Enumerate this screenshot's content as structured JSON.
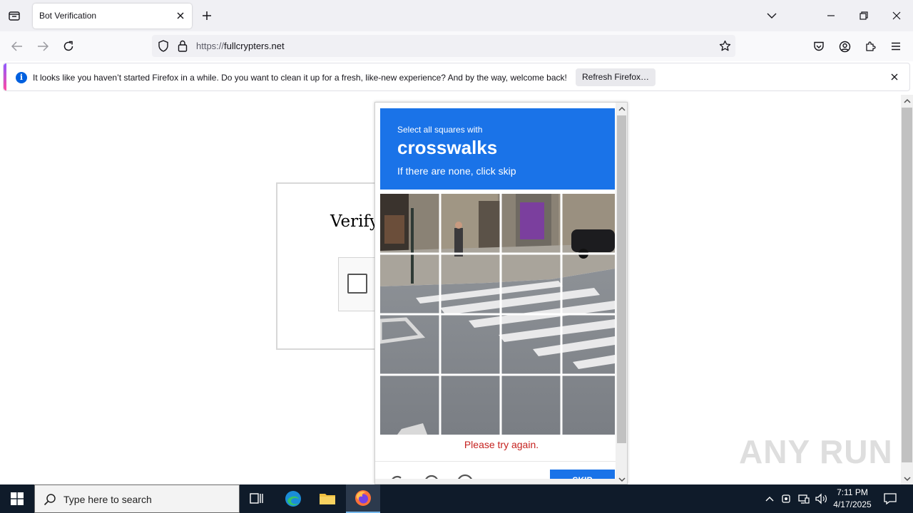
{
  "browser": {
    "tab": {
      "title": "Bot Verification"
    },
    "url": {
      "scheme": "https://",
      "host": "fullcrypters.net"
    },
    "notification": {
      "message": "It looks like you haven’t started Firefox in a while. Do you want to clean it up for a fresh, like-new experience? And by the way, welcome back!",
      "button_label": "Refresh Firefox…"
    }
  },
  "page": {
    "verify_title": "Verifyi",
    "challenge": {
      "instruction": "Select all squares with",
      "keyword": "crosswalks",
      "hint": "If there are none, click skip",
      "error": "Please try again.",
      "skip_label": "SKIP"
    },
    "watermark": "ANY RUN"
  },
  "taskbar": {
    "search_placeholder": "Type here to search",
    "time": "7:11 PM",
    "date": "4/17/2025"
  },
  "colors": {
    "challenge_header": "#1a73e8",
    "error_text": "#c5221f",
    "taskbar_bg": "#0f1b2a"
  }
}
